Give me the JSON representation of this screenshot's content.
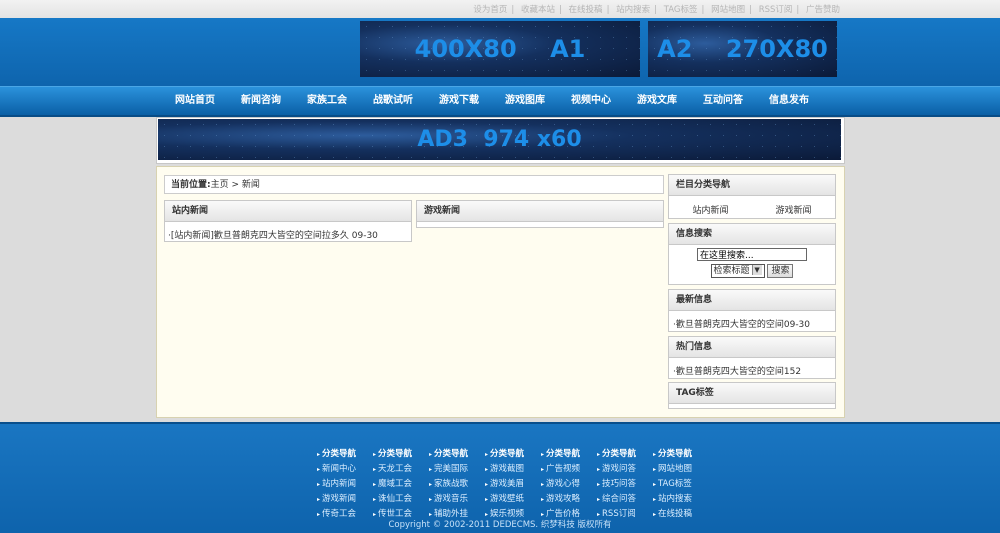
{
  "top_links": [
    "设为首页",
    "收藏本站",
    "在线投稿",
    "站内搜索",
    "TAG标签",
    "网站地图",
    "RSS订阅",
    "广告赞助"
  ],
  "ads": {
    "a1": "400X80    A1",
    "a2": "A2    270X80",
    "a3": "AD3  974 x60"
  },
  "nav": [
    "网站首页",
    "新闻咨询",
    "家族工会",
    "战歌试听",
    "游戏下载",
    "游戏图库",
    "视频中心",
    "游戏文库",
    "互动问答",
    "信息发布"
  ],
  "breadcrumb": {
    "label": "当前位置:",
    "path": "主页 > 新闻"
  },
  "site_news": {
    "title": "站内新闻",
    "item": "·[站内新闻]歡旦普朗克四大皆空的空间拉多久 09-30"
  },
  "game_news": {
    "title": "游戏新闻"
  },
  "sidebar": {
    "category_title": "栏目分类导航",
    "cat_left": "站内新闻",
    "cat_right": "游戏新闻",
    "search_title": "信息搜索",
    "search_placeholder": "在这里搜索...",
    "search_select": "检索标题",
    "search_button": "搜索",
    "latest_title": "最新信息",
    "latest_item": "·歡旦普朗克四大皆空的空间09-30",
    "hot_title": "热门信息",
    "hot_item": "·歡旦普朗克四大皆空的空间152",
    "tag_title": "TAG标签"
  },
  "footer": {
    "columns": [
      [
        "分类导航",
        "新闻中心",
        "站内新闻",
        "游戏新闻",
        "传奇工会"
      ],
      [
        "分类导航",
        "天龙工会",
        "魔域工会",
        "诛仙工会",
        "传世工会"
      ],
      [
        "分类导航",
        "完美国际",
        "家族战歌",
        "游戏音乐",
        "辅助外挂"
      ],
      [
        "分类导航",
        "游戏截图",
        "游戏美眉",
        "游戏壁纸",
        "娱乐视频"
      ],
      [
        "分类导航",
        "广告视频",
        "游戏心得",
        "游戏攻略",
        "广告价格"
      ],
      [
        "分类导航",
        "游戏问答",
        "技巧问答",
        "综合问答",
        "RSS订阅"
      ],
      [
        "分类导航",
        "网站地图",
        "TAG标签",
        "站内搜索",
        "在线投稿"
      ]
    ],
    "copyright": "Copyright © 2002-2011 DEDECMS. 织梦科技 版权所有"
  }
}
